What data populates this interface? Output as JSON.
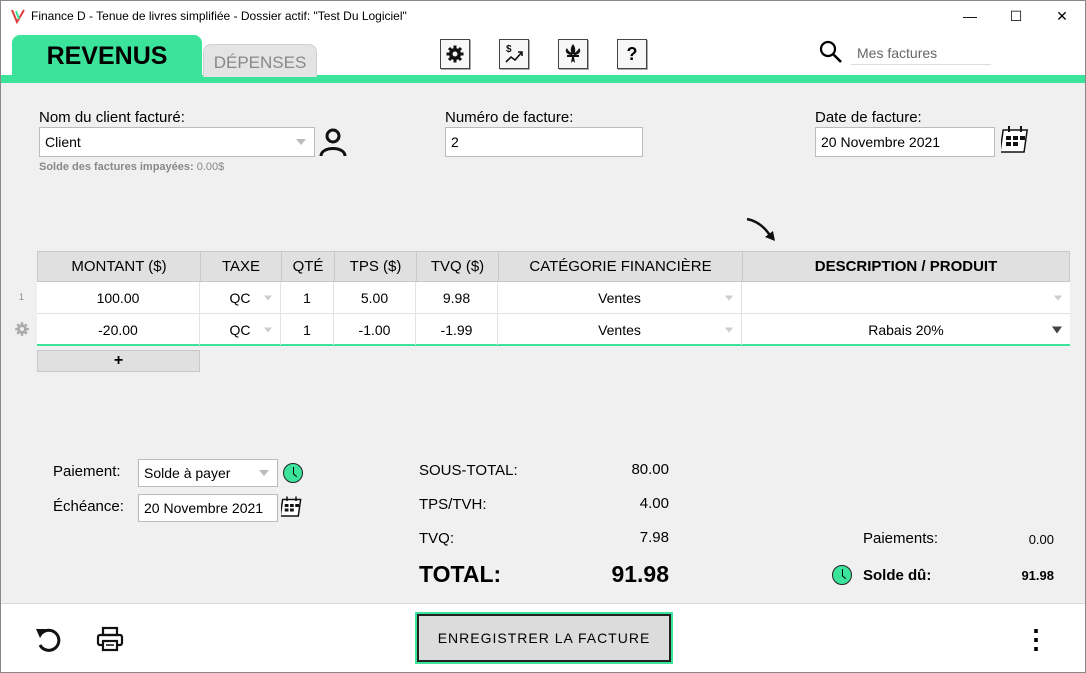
{
  "window": {
    "title": "Finance D - Tenue de livres simplifiée - Dossier actif: \"Test Du Logiciel\"",
    "minimize": "—",
    "maximize": "☐",
    "close": "✕"
  },
  "tabs": {
    "revenus": "REVENUS",
    "depenses": "DÉPENSES"
  },
  "toolbar": {
    "settings_icon": "gear-icon",
    "finance_icon": "dollar-chart-icon",
    "quebec_icon": "fleur-de-lis-icon",
    "help_label": "?"
  },
  "search": {
    "placeholder": "Mes factures"
  },
  "form": {
    "client_label": "Nom du client facturé:",
    "client_value": "Client",
    "balance_note_label": "Solde des factures impayées:",
    "balance_note_value": "0.00$",
    "invoice_number_label": "Numéro de facture:",
    "invoice_number_value": "2",
    "invoice_date_label": "Date de facture:",
    "invoice_date_value": "20 Novembre 2021"
  },
  "table": {
    "headers": [
      "MONTANT ($)",
      "TAXE",
      "QTÉ",
      "TPS ($)",
      "TVQ ($)",
      "CATÉGORIE FINANCIÈRE",
      "DESCRIPTION / PRODUIT"
    ],
    "rows": [
      {
        "num": "1",
        "montant": "100.00",
        "taxe": "QC",
        "qte": "1",
        "tps": "5.00",
        "tvq": "9.98",
        "categorie": "Ventes",
        "description": ""
      },
      {
        "num": "",
        "montant": "-20.00",
        "taxe": "QC",
        "qte": "1",
        "tps": "-1.00",
        "tvq": "-1.99",
        "categorie": "Ventes",
        "description": "Rabais 20%"
      }
    ],
    "add_row_label": "+"
  },
  "payment": {
    "payment_label": "Paiement:",
    "payment_value": "Solde à payer",
    "due_label": "Échéance:",
    "due_value": "20 Novembre 2021"
  },
  "totals": {
    "subtotal_label": "SOUS-TOTAL:",
    "subtotal_value": "80.00",
    "tps_label": "TPS/TVH:",
    "tps_value": "4.00",
    "tvq_label": "TVQ:",
    "tvq_value": "7.98",
    "total_label": "TOTAL:",
    "total_value": "91.98",
    "payments_label": "Paiements:",
    "payments_value": "0.00",
    "balance_label": "Solde dû:",
    "balance_value": "91.98"
  },
  "bottom": {
    "save_label": "ENREGISTRER LA FACTURE",
    "more_label": "⋮"
  },
  "colors": {
    "accent": "#3ce39a",
    "header_bg": "#e0e0e0",
    "window_bg": "#f0f0f0"
  }
}
